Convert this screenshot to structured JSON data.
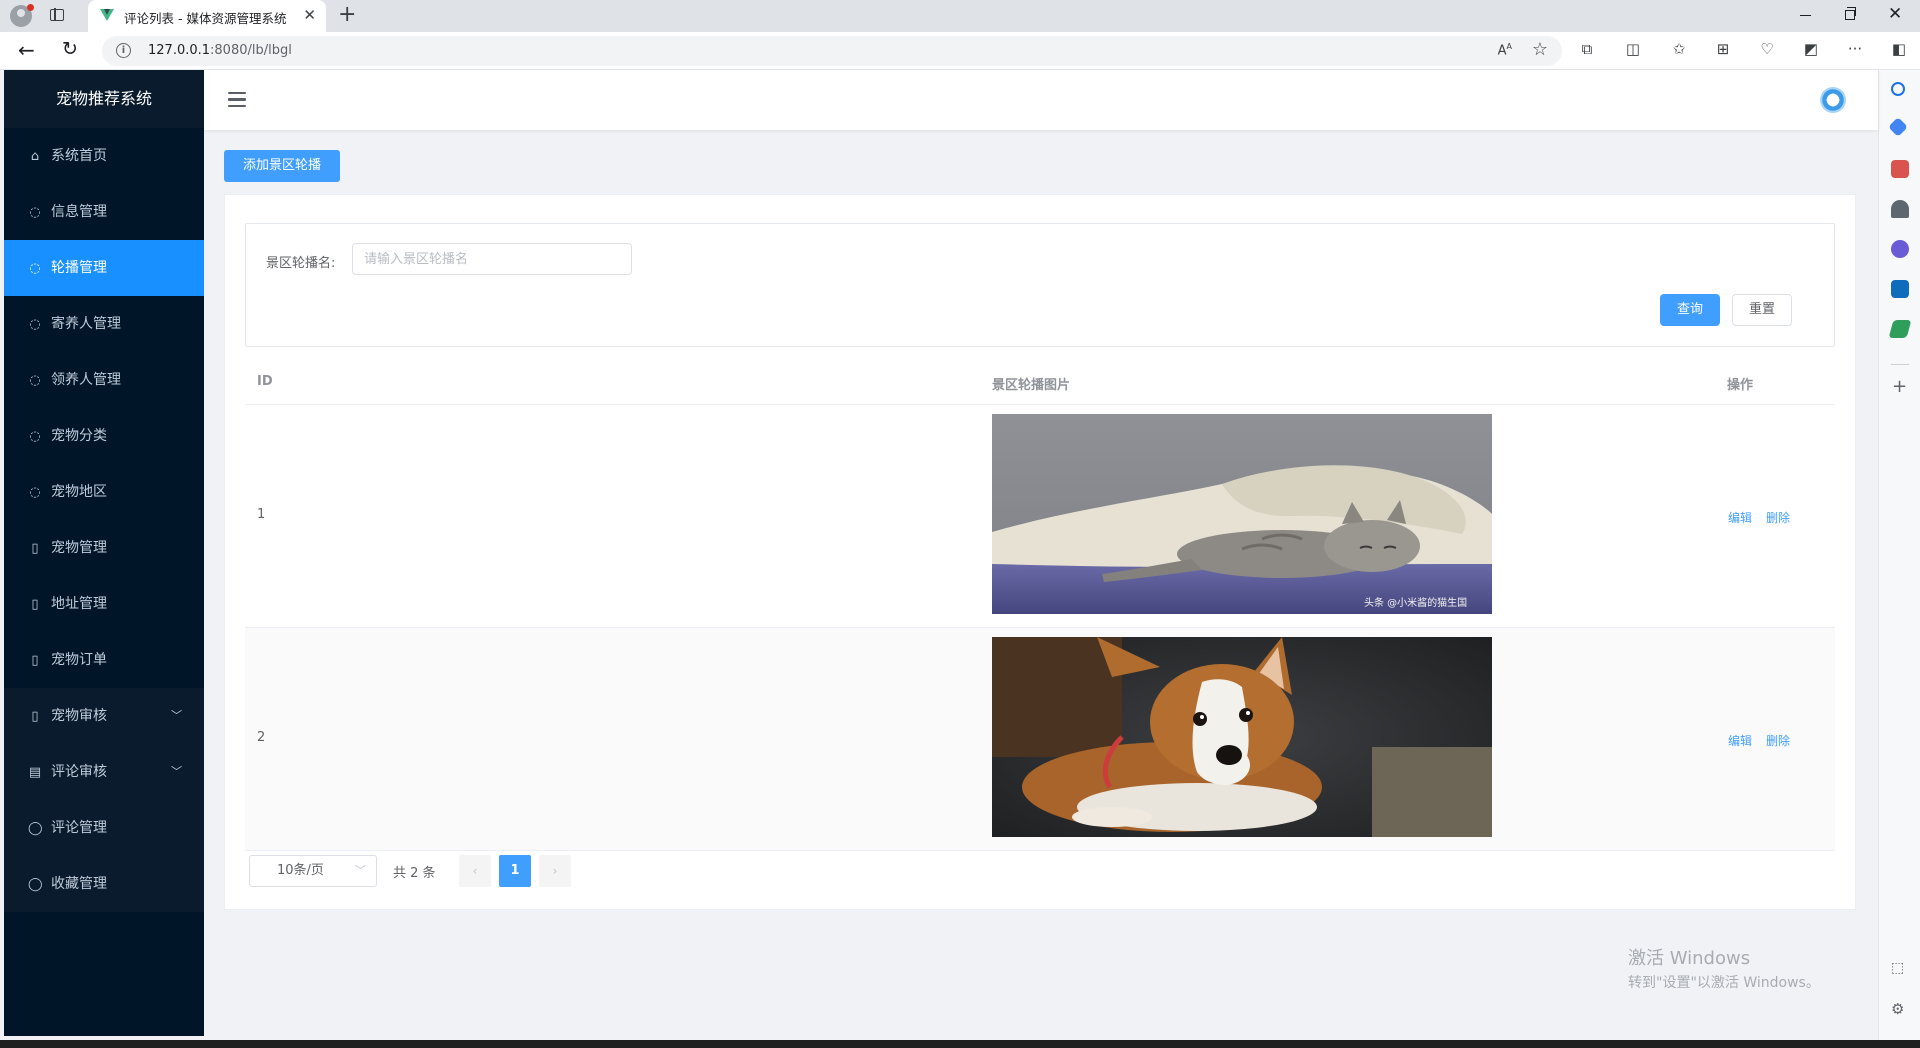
{
  "browser": {
    "tab_title": "评论列表 - 媒体资源管理系统",
    "url_host": "127.0.0.1",
    "url_rest": ":8080/lb/lbgl"
  },
  "sidebar": {
    "title": "宠物推荐系统",
    "items": [
      {
        "label": "系统首页",
        "icon": "home-icon"
      },
      {
        "label": "信息管理",
        "icon": "user-icon"
      },
      {
        "label": "轮播管理",
        "icon": "user-icon"
      },
      {
        "label": "寄养人管理",
        "icon": "user-icon"
      },
      {
        "label": "领养人管理",
        "icon": "user-icon"
      },
      {
        "label": "宠物分类",
        "icon": "user-icon"
      },
      {
        "label": "宠物地区",
        "icon": "user-icon"
      },
      {
        "label": "宠物管理",
        "icon": "notebook-icon"
      },
      {
        "label": "地址管理",
        "icon": "notebook-icon"
      },
      {
        "label": "宠物订单",
        "icon": "notebook-icon"
      },
      {
        "label": "宠物审核",
        "icon": "notebook-icon"
      },
      {
        "label": "评论审核",
        "icon": "document-icon"
      },
      {
        "label": "评论管理",
        "icon": "chat-icon"
      },
      {
        "label": "收藏管理",
        "icon": "chat-icon"
      }
    ]
  },
  "toolbar": {
    "add_label": "添加景区轮播"
  },
  "search": {
    "label": "景区轮播名:",
    "placeholder": "请输入景区轮播名",
    "value": "",
    "query_label": "查询",
    "reset_label": "重置"
  },
  "table": {
    "columns": [
      "ID",
      "景区轮播图片",
      "操作"
    ],
    "rows": [
      {
        "id": "1",
        "image": "sleeping-cat-photo",
        "watermark": "头条 @小米酱的猫生国"
      },
      {
        "id": "2",
        "image": "corgi-dog-photo"
      }
    ],
    "edit_label": "编辑",
    "delete_label": "删除"
  },
  "pagination": {
    "page_size": "10条/页",
    "total": "共 2 条",
    "current_page": "1"
  },
  "os_watermark": {
    "line1": "激活 Windows",
    "line2": "转到\"设置\"以激活 Windows。"
  },
  "colors": {
    "sidebar_bg": "#001528",
    "sidebar_active": "#1890ff",
    "primary": "#409eff"
  }
}
